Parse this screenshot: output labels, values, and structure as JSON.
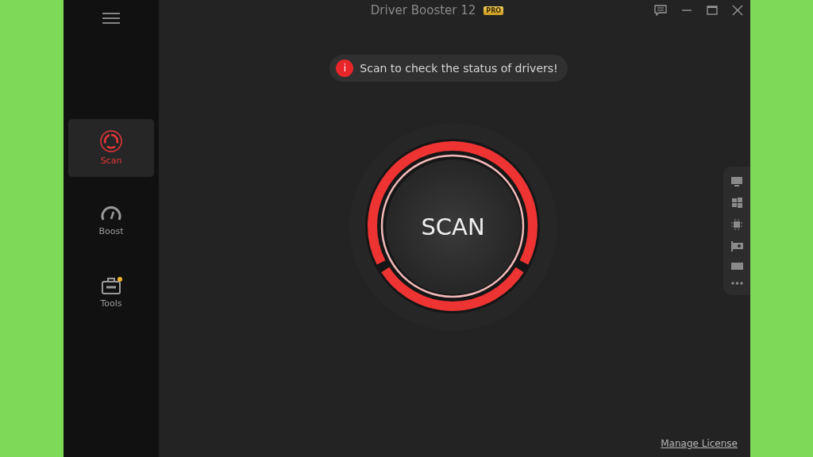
{
  "window": {
    "title": "Driver Booster 12",
    "edition_badge": "PRO"
  },
  "sidebar": {
    "items": [
      {
        "label": "Scan",
        "selected": true,
        "badge": false
      },
      {
        "label": "Boost",
        "selected": false,
        "badge": false
      },
      {
        "label": "Tools",
        "selected": false,
        "badge": true
      }
    ]
  },
  "notice": {
    "icon_text": "i",
    "message": "Scan to check the status of drivers!"
  },
  "scan_button": {
    "label": "SCAN"
  },
  "footer": {
    "link": "Manage License"
  }
}
